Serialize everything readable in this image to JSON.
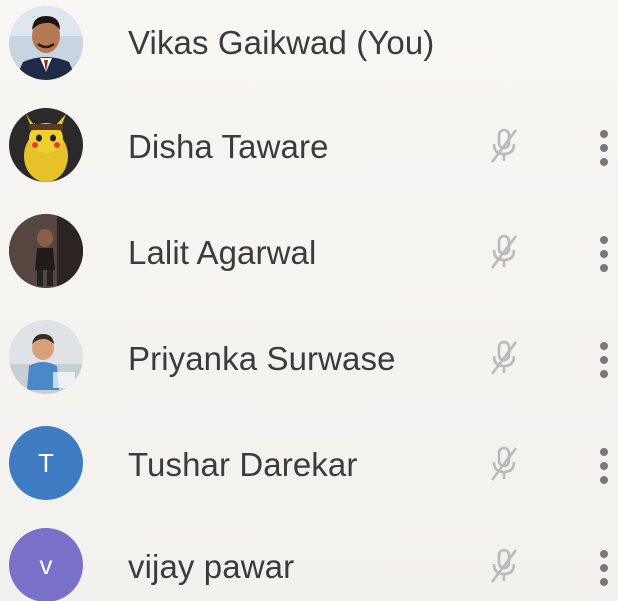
{
  "participants": [
    {
      "name": "Vikas Gaikwad (You)",
      "avatar": "photo",
      "is_self": true
    },
    {
      "name": "Disha Taware",
      "avatar": "photo",
      "mic": "mic-off-icon"
    },
    {
      "name": "Lalit Agarwal",
      "avatar": "photo",
      "mic": "mic-off-icon"
    },
    {
      "name": "Priyanka Surwase",
      "avatar": "photo",
      "mic": "mic-off-icon"
    },
    {
      "name": "Tushar Darekar",
      "avatar_letter": "T",
      "avatar_color": "#3f7bc0",
      "mic": "mic-off-icon"
    },
    {
      "name": "vijay pawar",
      "avatar_letter": "v",
      "avatar_color": "#7a6fc9",
      "mic": "mic-off-icon"
    }
  ],
  "colors": {
    "text": "#3a3b3d",
    "icon": "#b9babc",
    "more": "#77787a",
    "background": "#f4f3f0"
  }
}
